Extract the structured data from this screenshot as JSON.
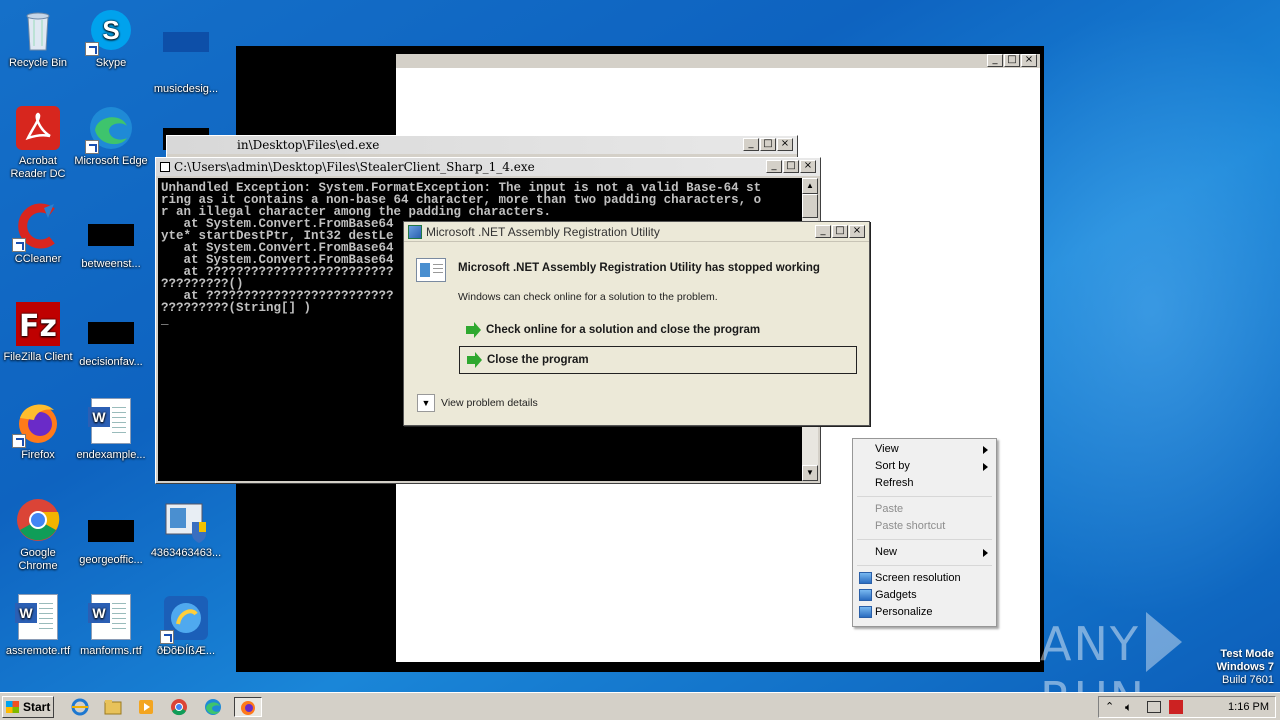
{
  "desktop": {
    "icons": [
      {
        "id": "recycle",
        "label": "Recycle Bin"
      },
      {
        "id": "skype",
        "label": "Skype"
      },
      {
        "id": "musicdesign",
        "label": "musicdesig..."
      },
      {
        "id": "acrobat",
        "label": "Acrobat Reader DC"
      },
      {
        "id": "edge",
        "label": "Microsoft Edge"
      },
      {
        "id": "ccleaner",
        "label": "CCleaner"
      },
      {
        "id": "betweenst",
        "label": "betweenst..."
      },
      {
        "id": "filezilla",
        "label": "FileZilla Client"
      },
      {
        "id": "decisionfav",
        "label": "decisionfav..."
      },
      {
        "id": "firefox",
        "label": "Firefox"
      },
      {
        "id": "endexample",
        "label": "endexample..."
      },
      {
        "id": "chrome",
        "label": "Google Chrome"
      },
      {
        "id": "georgeoffic",
        "label": "georgeoffic..."
      },
      {
        "id": "num",
        "label": "4363463463..."
      },
      {
        "id": "assremote",
        "label": "assremote.rtf"
      },
      {
        "id": "manforms",
        "label": "manforms.rtf"
      },
      {
        "id": "odd",
        "label": "ðÐõÐÍßÆ..."
      }
    ]
  },
  "console_back": {
    "title": "in\\Desktop\\Files\\ed.exe"
  },
  "console_front": {
    "title": "C:\\Users\\admin\\Desktop\\Files\\StealerClient_Sharp_1_4.exe",
    "lines": [
      "Unhandled Exception: System.FormatException: The input is not a valid Base-64 st",
      "ring as it contains a non-base 64 character, more than two padding characters, o",
      "r an illegal character among the padding characters.",
      "   at System.Convert.FromBase64",
      "yte* startDestPtr, Int32 destLe",
      "   at System.Convert.FromBase64",
      "   at System.Convert.FromBase64",
      "   at ?????????????????????????",
      "?????????()",
      "   at ?????????????????????????",
      "?????????(String[] )",
      "_"
    ]
  },
  "dialog": {
    "title": "Microsoft .NET Assembly Registration Utility",
    "heading": "Microsoft .NET Assembly Registration Utility has stopped working",
    "subtext": "Windows can check online for a solution to the problem.",
    "option1": "Check online for a solution and close the program",
    "option2": "Close the program",
    "details": "View problem details"
  },
  "context_menu": {
    "view": "View",
    "sort_by": "Sort by",
    "refresh": "Refresh",
    "paste": "Paste",
    "paste_shortcut": "Paste shortcut",
    "new": "New",
    "screen_resolution": "Screen resolution",
    "gadgets": "Gadgets",
    "personalize": "Personalize"
  },
  "watermark": {
    "left": "ANY",
    "right": "RUN",
    "mode": "Test Mode",
    "os": "Windows 7",
    "build": "Build 7601"
  },
  "taskbar": {
    "start": "Start",
    "clock": "1:16 PM"
  }
}
